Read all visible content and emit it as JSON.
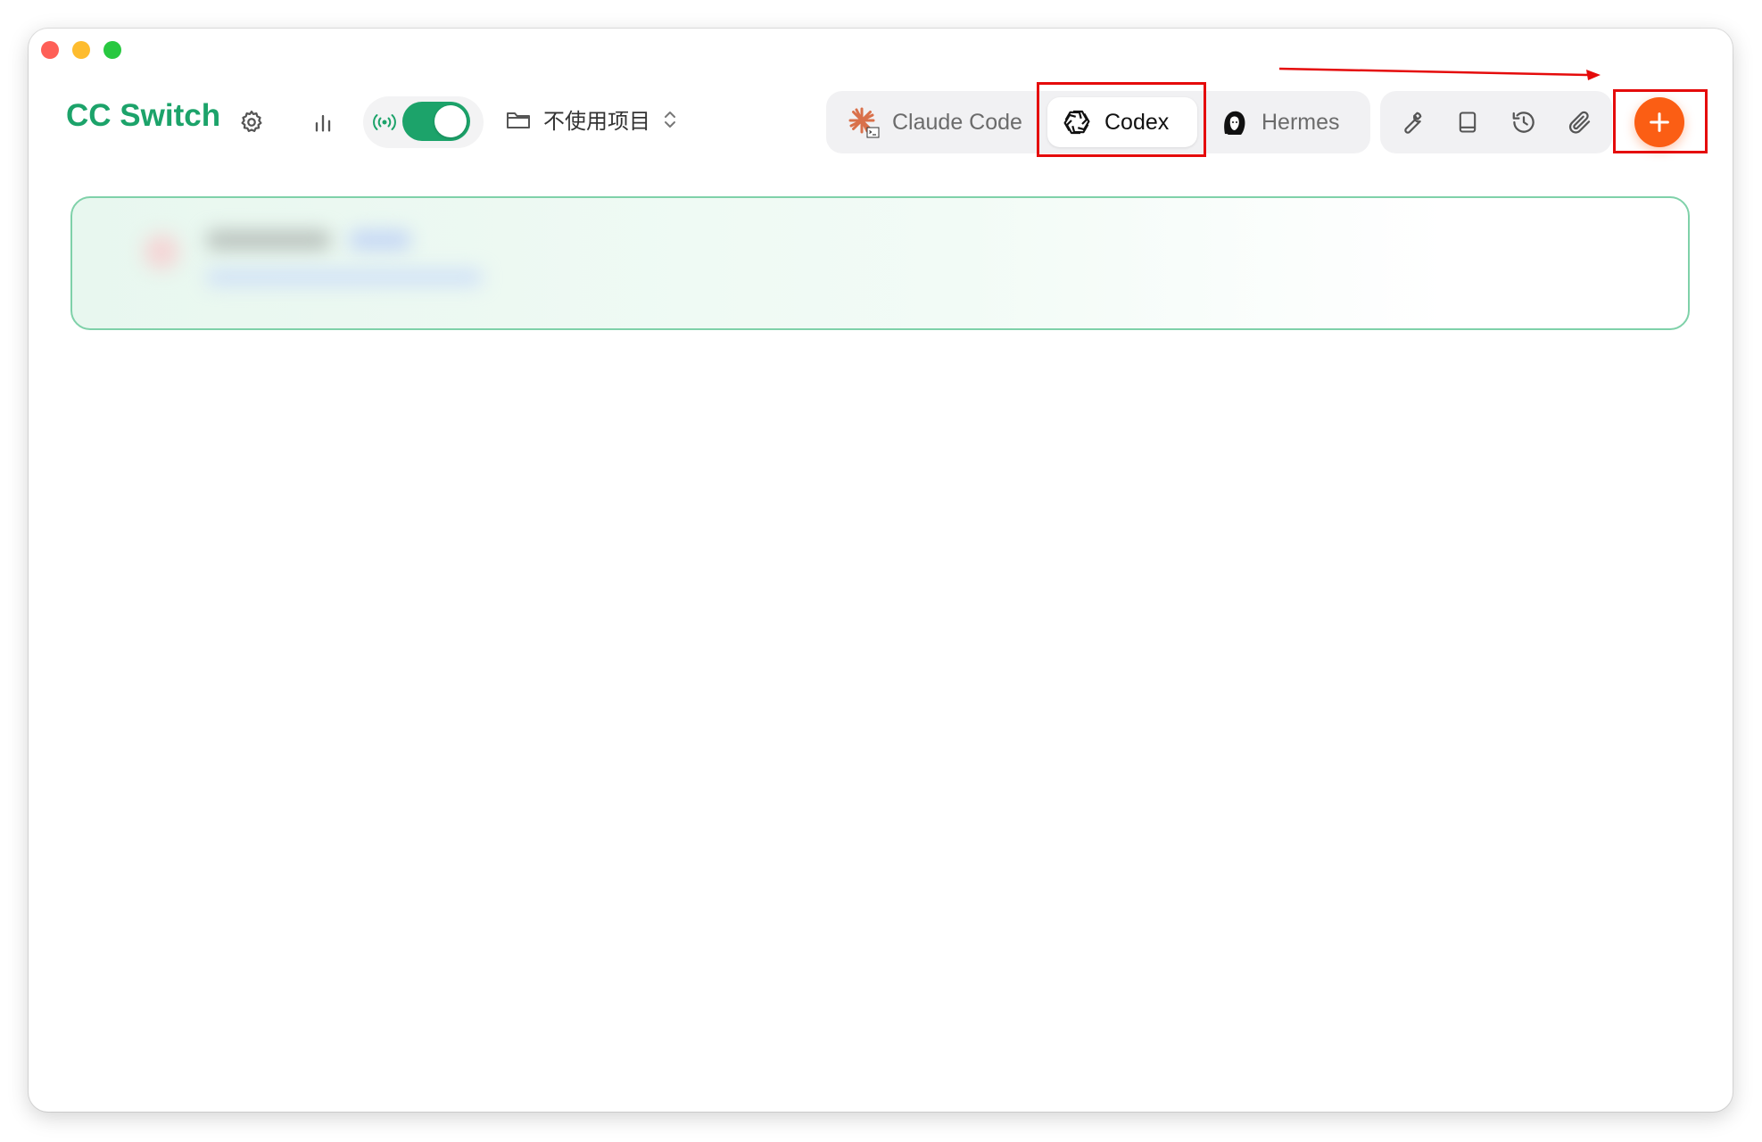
{
  "app": {
    "title": "CC Switch"
  },
  "project_selector": {
    "label": "不使用项目"
  },
  "tabs": [
    {
      "label": "Claude Code",
      "icon": "claude-code-icon",
      "active": false
    },
    {
      "label": "Codex",
      "icon": "openai-icon",
      "active": true
    },
    {
      "label": "Hermes",
      "icon": "hermes-icon",
      "active": false
    }
  ],
  "toggle": {
    "on": true,
    "icon": "broadcast-icon"
  },
  "toolbar": {
    "icons": [
      "wrench-icon",
      "book-icon",
      "history-icon",
      "paperclip-icon"
    ]
  },
  "add_button": {
    "icon": "plus-icon"
  },
  "colors": {
    "brand": "#1ca36a",
    "accent": "#fb5e14",
    "highlight": "#e50b0b",
    "card_border": "#7fd1a9"
  }
}
